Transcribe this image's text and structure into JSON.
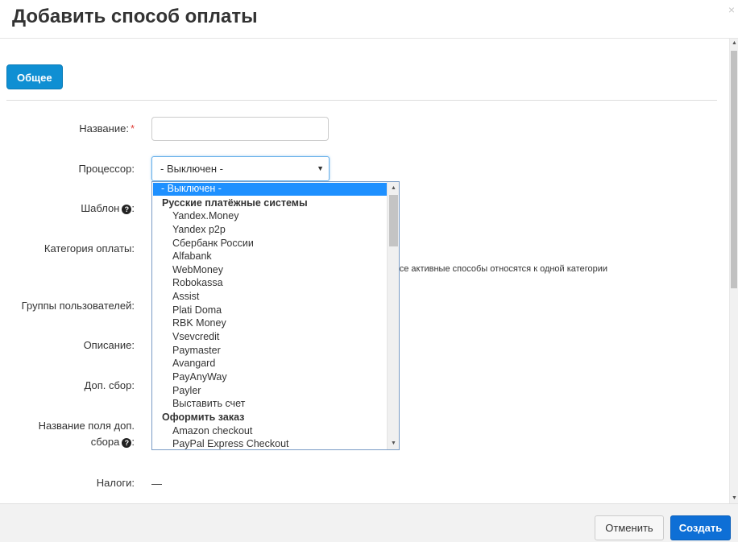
{
  "modal": {
    "title": "Добавить способ оплаты",
    "close_symbol": "×"
  },
  "tabs": [
    {
      "label": "Общее"
    }
  ],
  "form": {
    "name_label": "Название:",
    "required_mark": "*",
    "processor_label": "Процессор:",
    "processor_value": "- Выключен -",
    "template_label": "Шаблон",
    "category_label": "Категория оплаты:",
    "category_hint": "все активные способы относятся к одной категории",
    "usergroups_label": "Группы пользователей:",
    "description_label": "Описание:",
    "surcharge_label": "Доп. сбор:",
    "surcharge_title_label_line1": "Название поля доп.",
    "surcharge_title_label_line2": "сбора",
    "taxes_label": "Налоги:",
    "taxes_value": "—"
  },
  "dropdown": {
    "items": [
      {
        "type": "selected",
        "label": "- Выключен -"
      },
      {
        "type": "group",
        "label": "Русские платёжные системы"
      },
      {
        "type": "option",
        "label": "Yandex.Money"
      },
      {
        "type": "option",
        "label": "Yandex p2p"
      },
      {
        "type": "option",
        "label": "Сбербанк России"
      },
      {
        "type": "option",
        "label": "Alfabank"
      },
      {
        "type": "option",
        "label": "WebMoney"
      },
      {
        "type": "option",
        "label": "Robokassa"
      },
      {
        "type": "option",
        "label": "Assist"
      },
      {
        "type": "option",
        "label": "Plati Doma"
      },
      {
        "type": "option",
        "label": "RBK Money"
      },
      {
        "type": "option",
        "label": "Vsevcredit"
      },
      {
        "type": "option",
        "label": "Paymaster"
      },
      {
        "type": "option",
        "label": "Avangard"
      },
      {
        "type": "option",
        "label": "PayAnyWay"
      },
      {
        "type": "option",
        "label": "Payler"
      },
      {
        "type": "option",
        "label": "Выставить счет"
      },
      {
        "type": "group",
        "label": "Оформить заказ"
      },
      {
        "type": "option",
        "label": "Amazon checkout"
      },
      {
        "type": "option",
        "label": "PayPal Express Checkout"
      }
    ]
  },
  "footer": {
    "cancel_label": "Отменить",
    "create_label": "Создать"
  },
  "colors": {
    "primary": "#0e6fd6",
    "tab": "#0f8fd3",
    "selected_option": "#1e90ff",
    "required": "#e0403a"
  },
  "icons": [
    "close-icon",
    "help-icon",
    "caret-down-icon",
    "scroll-up-arrow-icon",
    "scroll-down-arrow-icon"
  ]
}
